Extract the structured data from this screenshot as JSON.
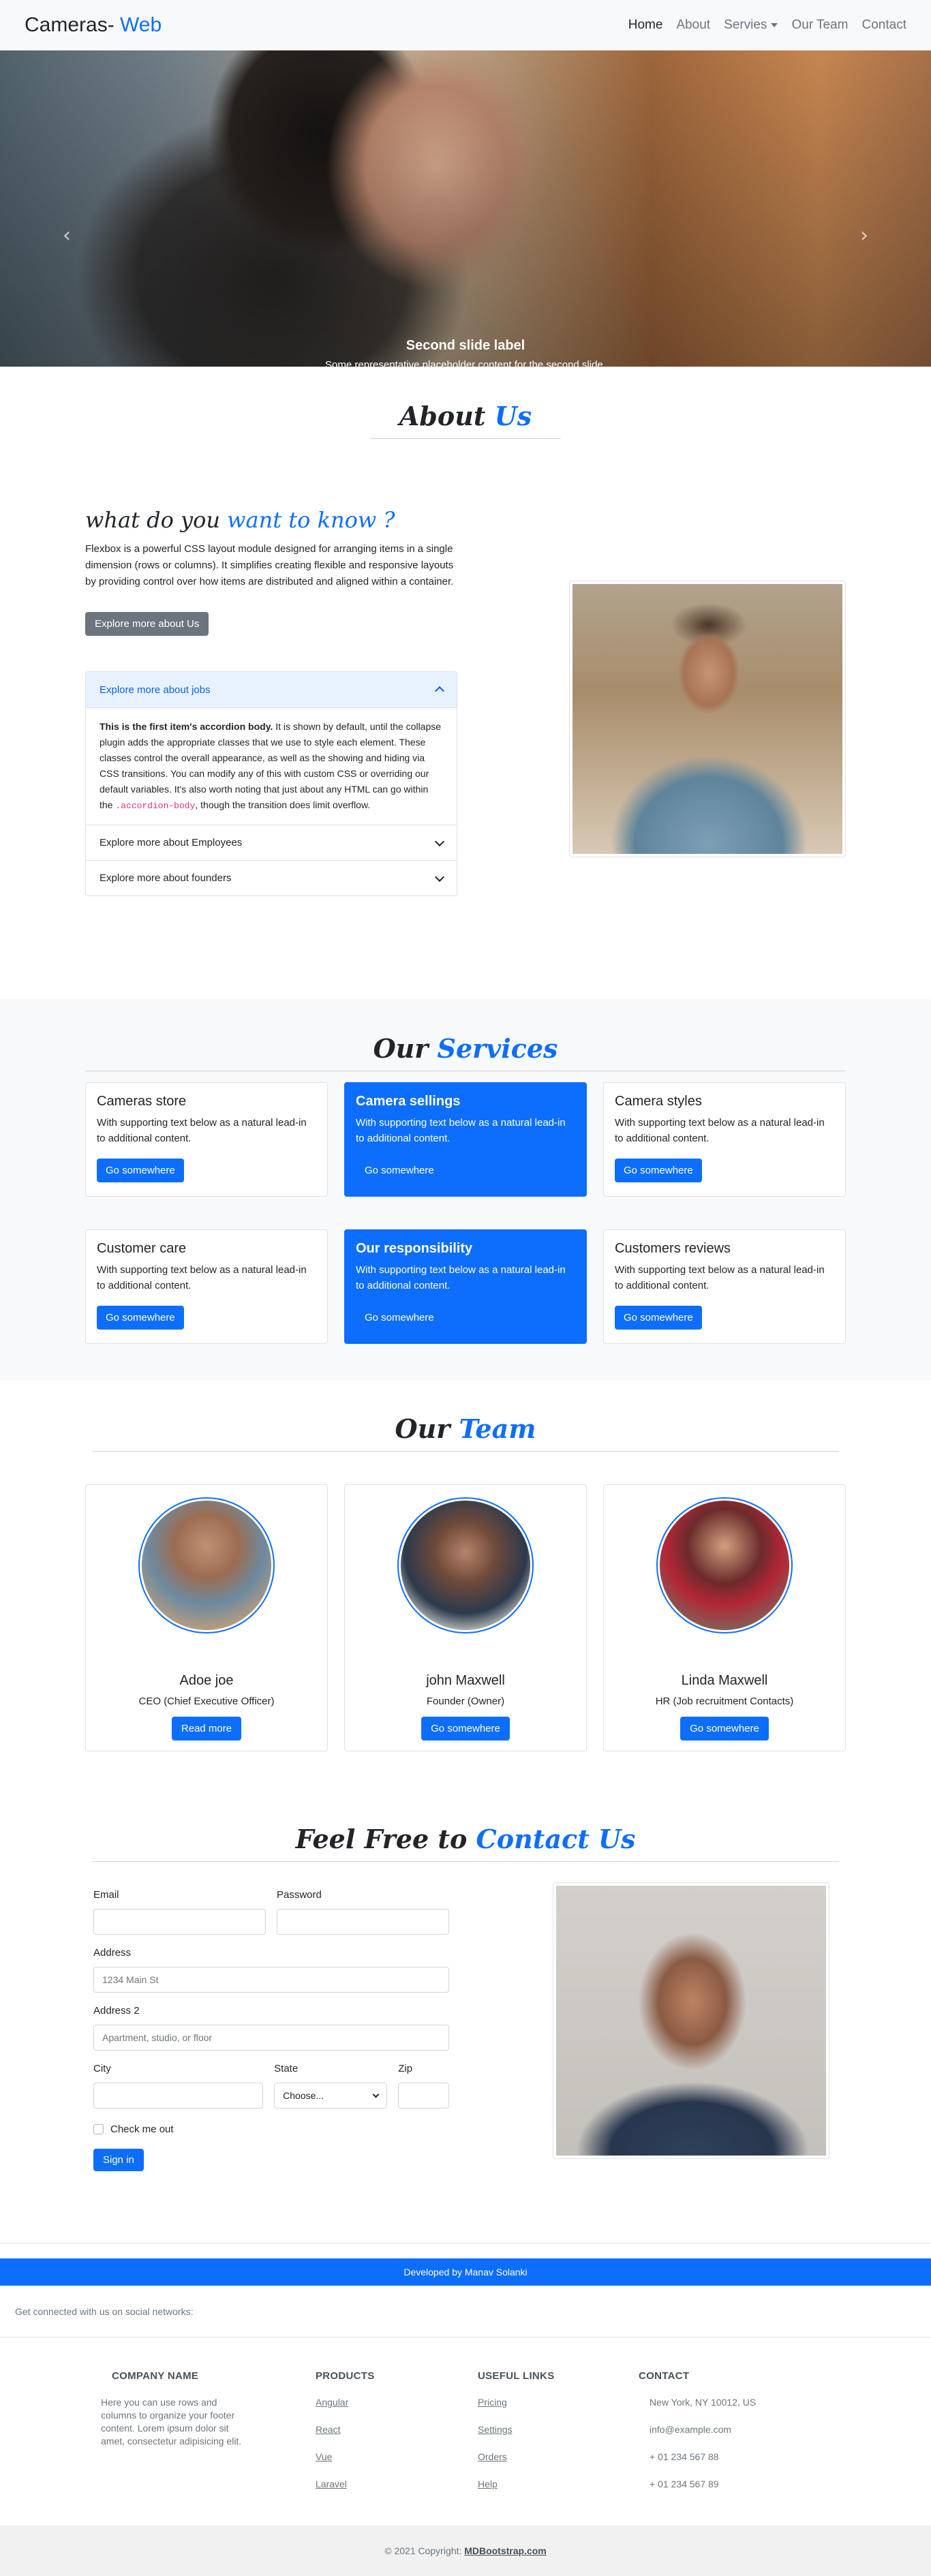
{
  "navbar": {
    "brand_main": "Cameras-",
    "brand_accent": " Web",
    "links": [
      "Home",
      "About",
      "Servies",
      "Our Team",
      "Contact"
    ]
  },
  "hero": {
    "caption_title": "Second slide label",
    "caption_text": "Some representative placeholder content for the second slide.",
    "prev_icon": "chevron-left-icon",
    "next_icon": "chevron-right-icon"
  },
  "about": {
    "title_main": "About",
    "title_accent": "Us",
    "heading_main": "what do you",
    "heading_accent": "want to know ?",
    "text": "Flexbox is a powerful CSS layout module designed for arranging items in a single dimension (rows or columns). It simplifies creating flexible and responsive layouts by providing control over how items are distributed and aligned within a container.",
    "button": "Explore more about Us",
    "accordion": [
      {
        "title": "Explore more about jobs",
        "body_bold": "This is the first item's accordion body.",
        "body_text": " It is shown by default, until the collapse plugin adds the appropriate classes that we use to style each element. These classes control the overall appearance, as well as the showing and hiding via CSS transitions. You can modify any of this with custom CSS or overriding our default variables. It's also worth noting that just about any HTML can go within the ",
        "body_code": ".accordion-body",
        "body_tail": ", though the transition does limit overflow."
      },
      {
        "title": "Explore more about Employees"
      },
      {
        "title": "Explore more about founders"
      }
    ]
  },
  "services": {
    "title_main": "Our",
    "title_accent": "Services",
    "cards": [
      {
        "title": "Cameras store",
        "text": "With supporting text below as a natural lead-in to additional content.",
        "button": "Go somewhere"
      },
      {
        "title": "Camera sellings",
        "text": "With supporting text below as a natural lead-in to additional content.",
        "button": "Go somewhere"
      },
      {
        "title": "Camera styles",
        "text": "With supporting text below as a natural lead-in to additional content.",
        "button": "Go somewhere"
      },
      {
        "title": "Customer care",
        "text": "With supporting text below as a natural lead-in to additional content.",
        "button": "Go somewhere"
      },
      {
        "title": "Our responsibility",
        "text": "With supporting text below as a natural lead-in to additional content.",
        "button": "Go somewhere"
      },
      {
        "title": "Customers reviews",
        "text": "With supporting text below as a natural lead-in to additional content.",
        "button": "Go somewhere"
      }
    ]
  },
  "team": {
    "title_main": "Our",
    "title_accent": "Team",
    "members": [
      {
        "name": "Adoe joe",
        "role": "CEO (Chief Executive Officer)",
        "button": "Read more"
      },
      {
        "name": "john Maxwell",
        "role": "Founder (Owner)",
        "button": "Go somewhere"
      },
      {
        "name": "Linda Maxwell",
        "role": "HR (Job recruitment Contacts)",
        "button": "Go somewhere"
      }
    ]
  },
  "contact": {
    "title_main": "Feel Free to",
    "title_accent": "Contact Us",
    "email_label": "Email",
    "password_label": "Password",
    "address_label": "Address",
    "address_placeholder": "1234 Main St",
    "address2_label": "Address 2",
    "address2_placeholder": "Apartment, studio, or floor",
    "city_label": "City",
    "state_label": "State",
    "state_value": "Choose...",
    "zip_label": "Zip",
    "check_label": "Check me out",
    "submit": "Sign in"
  },
  "footer": {
    "developer": "Developed by Manav Solanki",
    "social_text": "Get connected with us on social networks:",
    "company_title": "Company name",
    "company_text": "Here you can use rows and columns to organize your footer content. Lorem ipsum dolor sit amet, consectetur adipisicing elit.",
    "products_title": "Products",
    "products": [
      "Angular",
      "React",
      "Vue",
      "Laravel"
    ],
    "links_title": "Useful links",
    "links": [
      "Pricing",
      "Settings",
      "Orders",
      "Help"
    ],
    "contact_title": "Contact",
    "contacts": [
      "New York, NY 10012, US",
      "info@example.com",
      "+ 01 234 567 88",
      "+ 01 234 567 89"
    ],
    "copyright_prefix": "© 2021 Copyright: ",
    "copyright_link": "MDBootstrap.com"
  }
}
